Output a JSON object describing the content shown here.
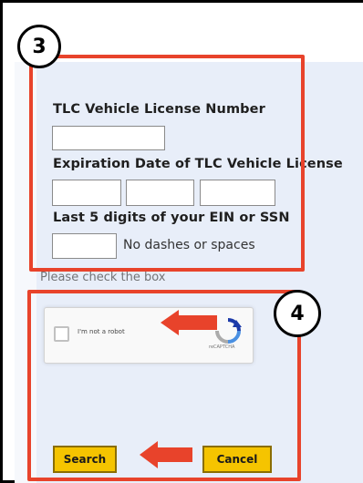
{
  "form": {
    "license_label": "TLC Vehicle License Number",
    "license_value": "",
    "expiration_label": "Expiration Date of TLC Vehicle License",
    "expiration_month": "",
    "expiration_day": "",
    "expiration_year": "",
    "ein_label": "Last 5 digits of your EIN or SSN",
    "ein_value": "",
    "ein_hint": "No dashes or spaces",
    "checkbox_hint": "Please check the box"
  },
  "captcha": {
    "label": "I'm not a robot",
    "brand": "reCAPTCHA"
  },
  "buttons": {
    "search": "Search",
    "cancel": "Cancel"
  },
  "annotations": {
    "step_3": "3",
    "step_4": "4",
    "highlight_color": "#e8432b",
    "arrow_color": "#e8432b"
  },
  "colors": {
    "panel_bg": "#e8eef9",
    "button_bg": "#f5c400"
  }
}
